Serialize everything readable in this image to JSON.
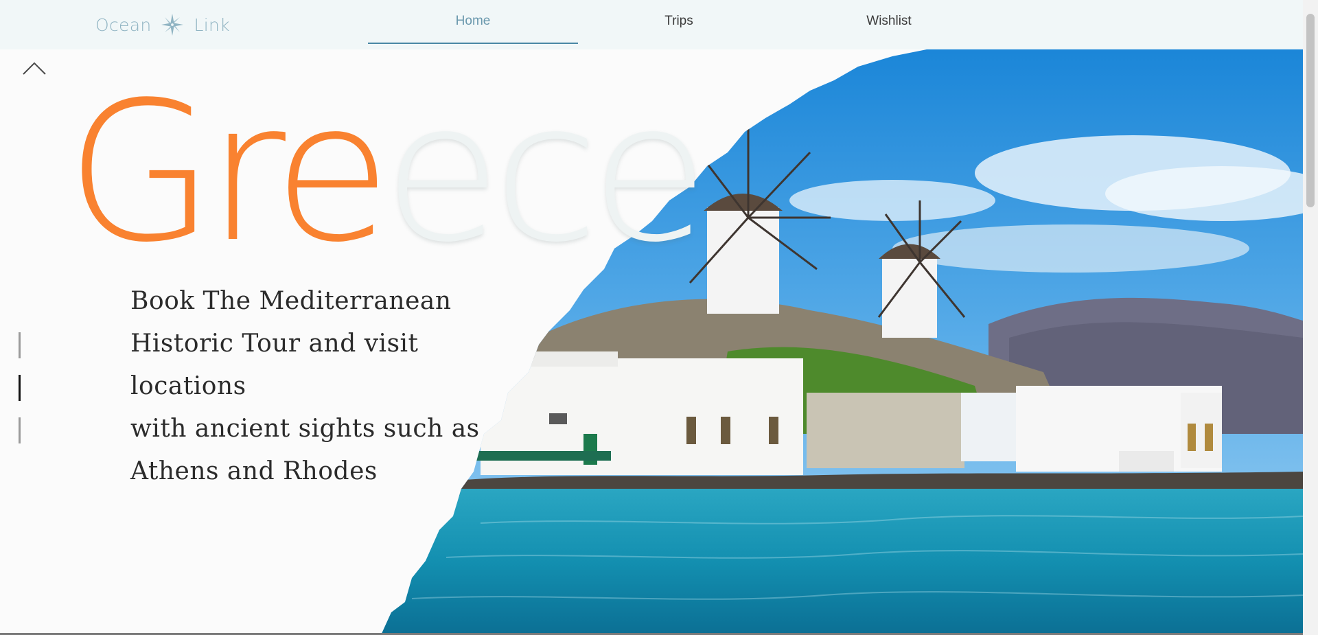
{
  "brand": {
    "left": "Ocean",
    "right": "Link",
    "icon": "compass-icon"
  },
  "nav": [
    {
      "label": "Home",
      "active": true
    },
    {
      "label": "Trips",
      "active": false
    },
    {
      "label": "Wishlist",
      "active": false
    }
  ],
  "hero": {
    "title_highlight": "Gre",
    "title_rest": "ece",
    "description_lines": [
      "Book The Mediterranean",
      "Historic Tour and visit locations",
      "with ancient sights such as",
      "Athens and Rhodes"
    ],
    "slides": {
      "count": 3,
      "active_index": 1
    }
  },
  "colors": {
    "accent_orange": "#f98230",
    "brand_blue": "#8fb3c2",
    "nav_active": "#6a98ad",
    "topbar_bg": "#f1f7f8"
  },
  "icons": [
    "compass-icon",
    "chevron-up-icon"
  ]
}
